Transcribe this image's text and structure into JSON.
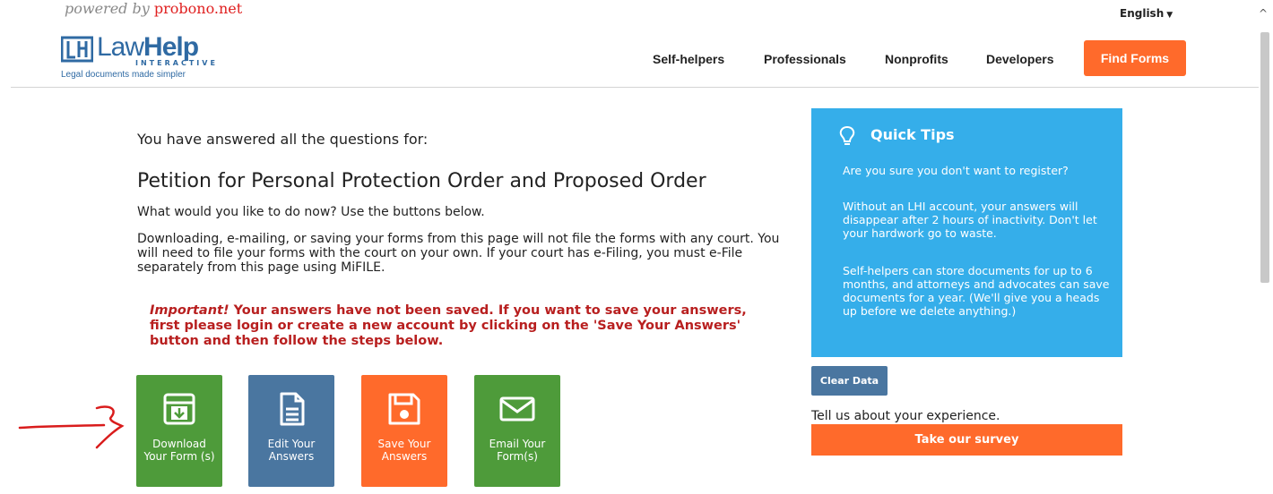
{
  "topbar": {
    "powered_prefix": "powered by ",
    "powered_brand": "probono.net",
    "language": "English"
  },
  "header": {
    "logo_law": "Law",
    "logo_help": "Help",
    "logo_sub": "INTERACTIVE",
    "logo_tagline": "Legal documents made simpler",
    "nav": [
      "Self-helpers",
      "Professionals",
      "Nonprofits",
      "Developers"
    ],
    "cta": "Find Forms"
  },
  "main": {
    "answered_heading": "You have answered all the questions for:",
    "form_title": "Petition for Personal Protection Order and Proposed Order",
    "instructions": "What would you like to do now? Use the buttons below.",
    "disclaimer": "Downloading, e-mailing, or saving your forms from this page will not file the forms with any court. You will need to file your forms with the court on your own. If your court has e-Filing, you must e-File separately from this page using MiFILE.",
    "important_label": "Important!",
    "important_text": " Your answers have not been saved. If you want to save your answers, first please login or create a new account by clicking on the 'Save Your Answers' button and then follow the steps below.",
    "actions": [
      {
        "label": "Download Your Form (s)",
        "icon": "download-icon",
        "color": "#4e9b3a"
      },
      {
        "label": "Edit Your Answers",
        "icon": "document-icon",
        "color": "#4a76a0"
      },
      {
        "label": "Save Your Answers",
        "icon": "save-icon",
        "color": "#ff6a2b"
      },
      {
        "label": "Email Your Form(s)",
        "icon": "envelope-icon",
        "color": "#4e9b3a"
      }
    ]
  },
  "sidebar": {
    "tips_title": "Quick Tips",
    "tips": [
      "Are you sure you don't want to register?",
      "Without an LHI account, your answers will disappear after 2 hours of inactivity. Don't let your hardwork go to waste.",
      "Self-helpers can store documents for up to 6 months, and attorneys and advocates can save documents for a year. (We'll give you a heads up before we delete anything.)"
    ],
    "clear_label": "Clear Data",
    "experience_text": "Tell us about your experience.",
    "survey_label": "Take our survey"
  },
  "colors": {
    "accent_orange": "#ff6a2b",
    "tips_blue": "#35aeea",
    "brand_blue": "#2f6aa3",
    "warning_red": "#b81f1f"
  }
}
